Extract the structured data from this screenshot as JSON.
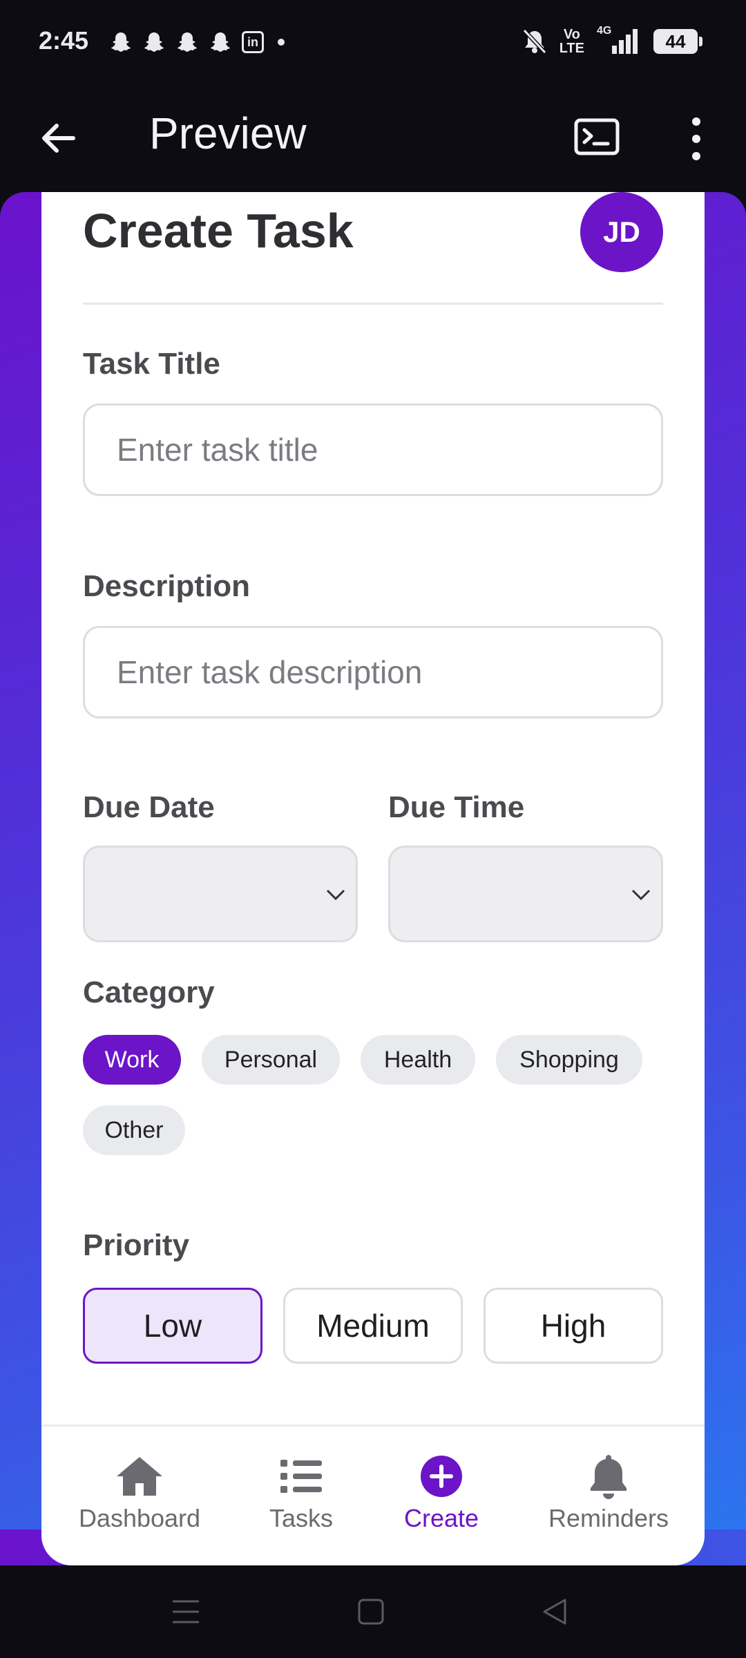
{
  "status_bar": {
    "time": "2:45",
    "notification_icons": [
      "snapchat-icon",
      "snapchat-icon",
      "snapchat-icon",
      "snapchat-icon",
      "linkedin-icon"
    ],
    "linkedin_label": "in",
    "network": "Vo\nLTE",
    "network_top": "Vo",
    "network_bottom": "LTE",
    "signal_label": "4G",
    "battery": "44"
  },
  "app_bar": {
    "title": "Preview",
    "back_icon": "arrow-left-icon",
    "terminal_icon": "terminal-icon",
    "more_icon": "more-vertical-icon"
  },
  "form": {
    "title": "Create Task",
    "avatar_initials": "JD",
    "task_title": {
      "label": "Task Title",
      "placeholder": "Enter task title",
      "value": ""
    },
    "description": {
      "label": "Description",
      "placeholder": "Enter task description",
      "value": ""
    },
    "due_date": {
      "label": "Due Date",
      "value": ""
    },
    "due_time": {
      "label": "Due Time",
      "value": ""
    },
    "category": {
      "label": "Category",
      "options": [
        "Work",
        "Personal",
        "Health",
        "Shopping",
        "Other"
      ],
      "selected": "Work"
    },
    "priority": {
      "label": "Priority",
      "options": [
        "Low",
        "Medium",
        "High"
      ],
      "selected": "Low"
    }
  },
  "bottom_nav": {
    "items": [
      {
        "label": "Dashboard",
        "icon": "home-icon"
      },
      {
        "label": "Tasks",
        "icon": "list-icon"
      },
      {
        "label": "Create",
        "icon": "plus-circle-icon"
      },
      {
        "label": "Reminders",
        "icon": "bell-icon"
      }
    ],
    "active": "Create"
  },
  "colors": {
    "accent": "#6c14c8",
    "gradient_start": "#6a12cc",
    "gradient_end": "#2a77f0",
    "chip_bg": "#e9eaee",
    "priority_active_bg": "#ede6fa"
  }
}
